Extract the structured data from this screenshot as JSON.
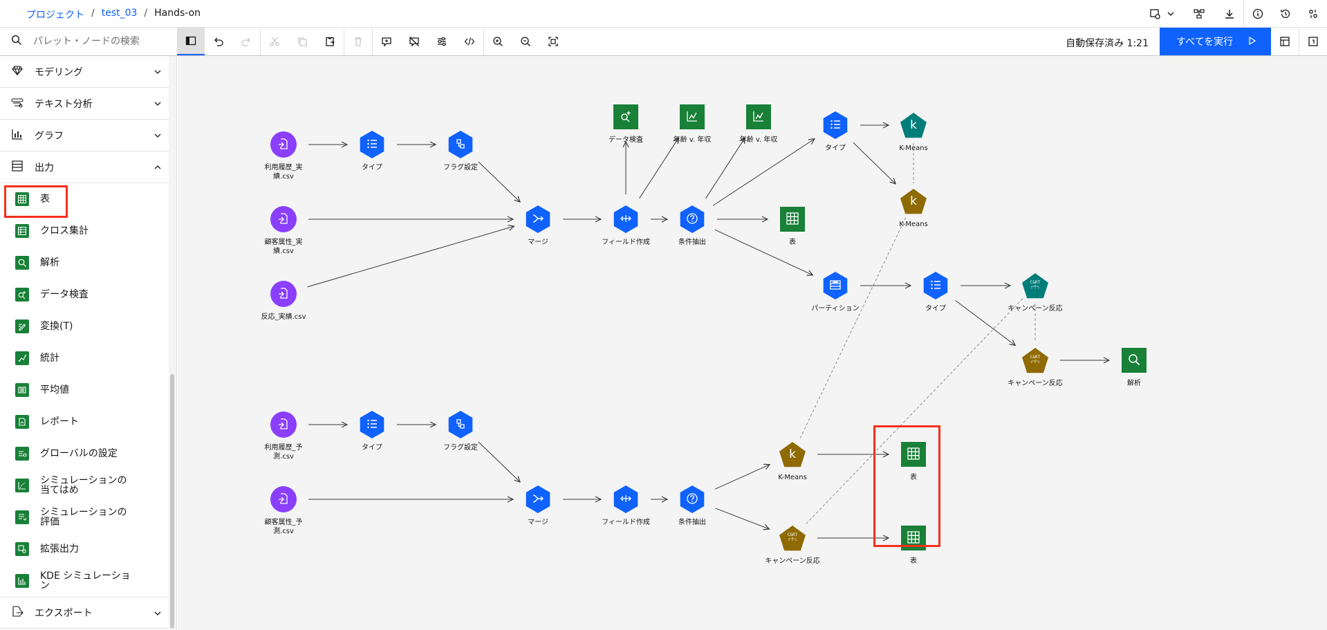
{
  "breadcrumb": {
    "project": "プロジェクト",
    "flow": "test_03",
    "current": "Hands-on"
  },
  "search": {
    "placeholder": "パレット・ノードの検索"
  },
  "toolbar": {
    "autosave": "自動保存済み 1:21",
    "run_all": "すべてを実行"
  },
  "sidebar": {
    "categories": [
      {
        "label": "モデリング",
        "icon": "diamond-icon",
        "expanded": false
      },
      {
        "label": "テキスト分析",
        "icon": "text-analysis-icon",
        "expanded": false
      },
      {
        "label": "グラフ",
        "icon": "bar-chart-icon",
        "expanded": false
      },
      {
        "label": "出力",
        "icon": "table-list-icon",
        "expanded": true
      }
    ],
    "output_items": [
      {
        "label": "表",
        "icon": "table-icon",
        "selected": true
      },
      {
        "label": "クロス集計",
        "icon": "crosstab-icon"
      },
      {
        "label": "解析",
        "icon": "analysis-icon"
      },
      {
        "label": "データ検査",
        "icon": "data-audit-icon"
      },
      {
        "label": "変換(T)",
        "icon": "transform-icon"
      },
      {
        "label": "統計",
        "icon": "statistics-icon"
      },
      {
        "label": "平均値",
        "icon": "means-icon"
      },
      {
        "label": "レポート",
        "icon": "report-icon"
      },
      {
        "label": "グローバルの設定",
        "icon": "global-settings-icon"
      },
      {
        "label": "シミュレーションの\n当てはめ",
        "icon": "sim-fit-icon"
      },
      {
        "label": "シミュレーションの\n評価",
        "icon": "sim-eval-icon"
      },
      {
        "label": "拡張出力",
        "icon": "extension-output-icon"
      },
      {
        "label": "KDE シミュレーショ\nン",
        "icon": "kde-icon"
      }
    ],
    "export": {
      "label": "エクスポート",
      "icon": "export-icon"
    }
  },
  "canvas": {
    "nodes": [
      {
        "id": "n1",
        "label": "利用履歴_実\n績.csv",
        "kind": "source",
        "icon": "import-file-icon"
      },
      {
        "id": "n2",
        "label": "タイプ",
        "kind": "field-op",
        "icon": "type-icon"
      },
      {
        "id": "n3",
        "label": "フラグ設定",
        "kind": "field-op",
        "icon": "set-to-flag-icon"
      },
      {
        "id": "n4",
        "label": "顧客属性_実\n績.csv",
        "kind": "source",
        "icon": "import-file-icon"
      },
      {
        "id": "n5",
        "label": "反応_実績.csv",
        "kind": "source",
        "icon": "import-file-icon"
      },
      {
        "id": "n6",
        "label": "マージ",
        "kind": "record-op",
        "icon": "merge-icon"
      },
      {
        "id": "n7",
        "label": "フィールド作成",
        "kind": "record-op",
        "icon": "derive-icon"
      },
      {
        "id": "n8",
        "label": "条件抽出",
        "kind": "record-op",
        "icon": "select-icon"
      },
      {
        "id": "n9",
        "label": "データ検査",
        "kind": "output",
        "icon": "data-audit-icon"
      },
      {
        "id": "n10",
        "label": "年齢 v. 年収",
        "kind": "output",
        "icon": "plot-icon"
      },
      {
        "id": "n11",
        "label": "年齢 v. 年収",
        "kind": "output",
        "icon": "plot-icon"
      },
      {
        "id": "n12",
        "label": "タイプ",
        "kind": "field-op",
        "icon": "type-icon"
      },
      {
        "id": "n13",
        "label": "K-Means",
        "kind": "model",
        "icon": "kmeans-icon"
      },
      {
        "id": "n14",
        "label": "K-Means",
        "kind": "nugget",
        "icon": "kmeans-icon"
      },
      {
        "id": "n15",
        "label": "表",
        "kind": "output",
        "icon": "table-icon"
      },
      {
        "id": "n16",
        "label": "パーティション",
        "kind": "field-op",
        "icon": "partition-icon"
      },
      {
        "id": "n17",
        "label": "タイプ",
        "kind": "field-op",
        "icon": "type-icon"
      },
      {
        "id": "n18",
        "label": "キャンペーン反応",
        "kind": "model",
        "icon": "cart-icon"
      },
      {
        "id": "n19",
        "label": "キャンペーン反応",
        "kind": "nugget",
        "icon": "cart-icon"
      },
      {
        "id": "n20",
        "label": "解析",
        "kind": "output",
        "icon": "analysis-icon"
      },
      {
        "id": "n21",
        "label": "利用履歴_予\n測.csv",
        "kind": "source",
        "icon": "import-file-icon"
      },
      {
        "id": "n22",
        "label": "タイプ",
        "kind": "field-op",
        "icon": "type-icon"
      },
      {
        "id": "n23",
        "label": "フラグ設定",
        "kind": "field-op",
        "icon": "set-to-flag-icon"
      },
      {
        "id": "n24",
        "label": "顧客属性_予\n測.csv",
        "kind": "source",
        "icon": "import-file-icon"
      },
      {
        "id": "n25",
        "label": "マージ",
        "kind": "record-op",
        "icon": "merge-icon"
      },
      {
        "id": "n26",
        "label": "フィールド作成",
        "kind": "record-op",
        "icon": "derive-icon"
      },
      {
        "id": "n27",
        "label": "条件抽出",
        "kind": "record-op",
        "icon": "select-icon"
      },
      {
        "id": "n28",
        "label": "K-Means",
        "kind": "nugget",
        "icon": "kmeans-icon"
      },
      {
        "id": "n29",
        "label": "キャンペーン反応",
        "kind": "nugget",
        "icon": "cart-icon"
      },
      {
        "id": "n30",
        "label": "表",
        "kind": "output",
        "icon": "table-icon"
      },
      {
        "id": "n31",
        "label": "表",
        "kind": "output",
        "icon": "table-icon"
      }
    ],
    "links": [
      [
        "n1",
        "n2"
      ],
      [
        "n2",
        "n3"
      ],
      [
        "n3",
        "n6"
      ],
      [
        "n4",
        "n6"
      ],
      [
        "n5",
        "n6"
      ],
      [
        "n6",
        "n7"
      ],
      [
        "n7",
        "n8"
      ],
      [
        "n7",
        "n9"
      ],
      [
        "n7",
        "n10"
      ],
      [
        "n8",
        "n11"
      ],
      [
        "n8",
        "n12"
      ],
      [
        "n8",
        "n15"
      ],
      [
        "n8",
        "n16"
      ],
      [
        "n12",
        "n13"
      ],
      [
        "n12",
        "n14"
      ],
      [
        "n16",
        "n17"
      ],
      [
        "n17",
        "n18"
      ],
      [
        "n17",
        "n19"
      ],
      [
        "n19",
        "n20"
      ],
      [
        "n21",
        "n22"
      ],
      [
        "n22",
        "n23"
      ],
      [
        "n23",
        "n25"
      ],
      [
        "n24",
        "n25"
      ],
      [
        "n25",
        "n26"
      ],
      [
        "n26",
        "n27"
      ],
      [
        "n27",
        "n28"
      ],
      [
        "n27",
        "n29"
      ],
      [
        "n28",
        "n30"
      ],
      [
        "n29",
        "n31"
      ]
    ],
    "model_links": [
      [
        "n13",
        "n14"
      ],
      [
        "n18",
        "n19"
      ],
      [
        "n14",
        "n28"
      ],
      [
        "n18",
        "n29"
      ]
    ]
  },
  "colors": {
    "source": "#8a3ffc",
    "op": "#0f62fe",
    "output": "#198038",
    "model": "#007d79",
    "nugget": "#8e6a00",
    "highlight": "#f62f1a"
  }
}
